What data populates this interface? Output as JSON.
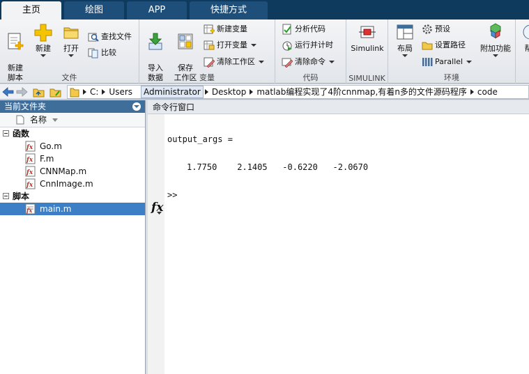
{
  "tabs": [
    {
      "label": "主页",
      "active": true
    },
    {
      "label": "绘图",
      "active": false
    },
    {
      "label": "APP",
      "active": false
    },
    {
      "label": "快捷方式",
      "active": false
    }
  ],
  "ribbon": {
    "file": {
      "label": "文件",
      "new_script": "新建\n脚本",
      "new": "新建",
      "open": "打开",
      "find_files": "查找文件",
      "compare": "比较"
    },
    "variable": {
      "label": "变量",
      "import_data": "导入\n数据",
      "save_workspace": "保存\n工作区",
      "new_variable": "新建变量",
      "open_variable": "打开变量",
      "clear_workspace": "清除工作区"
    },
    "code": {
      "label": "代码",
      "analyze_code": "分析代码",
      "run_and_time": "运行并计时",
      "clear_commands": "清除命令"
    },
    "simulink": {
      "label": "SIMULINK",
      "simulink": "Simulink"
    },
    "environment": {
      "label": "环境",
      "layout": "布局",
      "preferences": "预设",
      "set_path": "设置路径",
      "parallel": "Parallel",
      "addons": "附加功能"
    },
    "help_partial": "帮"
  },
  "address": {
    "crumbs": [
      {
        "label": "C:",
        "highlight": false
      },
      {
        "label": "Users",
        "highlight": false
      },
      {
        "label": "Administrator",
        "highlight": true
      },
      {
        "label": "Desktop",
        "highlight": false
      },
      {
        "label": "matlab编程实现了4阶cnnmap,有着n多的文件源码程序",
        "highlight": false
      },
      {
        "label": "code",
        "highlight": false
      }
    ]
  },
  "current_folder": {
    "title": "当前文件夹",
    "column_name": "名称",
    "categories": [
      {
        "label": "函数",
        "files": [
          "Go.m",
          "F.m",
          "CNNMap.m",
          "CnnImage.m"
        ]
      },
      {
        "label": "脚本",
        "files": [
          "main.m"
        ]
      }
    ],
    "selected_file": "main.m"
  },
  "command_window": {
    "title": "命令行窗口",
    "output_var": "output_args =",
    "output_values": "1.7750    2.1405   -0.6220   -2.0670",
    "prompt": ">>",
    "fx_label": "fx"
  },
  "colors": {
    "tab_strip": "#0e3a5e",
    "panel_title": "#3f6e9b",
    "selection": "#3d7fc6"
  }
}
